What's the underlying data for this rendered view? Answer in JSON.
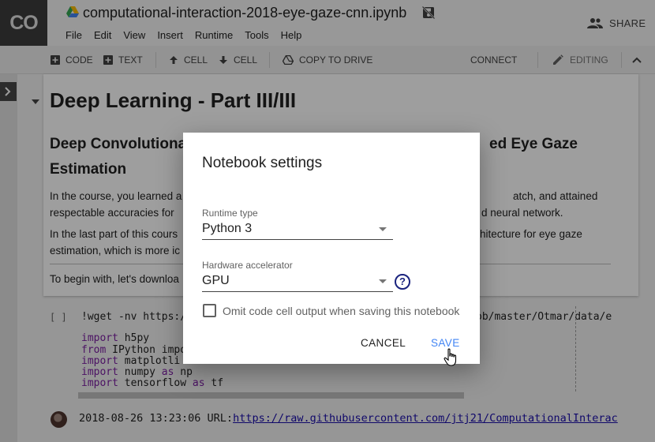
{
  "header": {
    "logo": "CO",
    "notebook_title": "computational-interaction-2018-eye-gaze-cnn.ipynb",
    "share_label": "SHARE",
    "menu": [
      "File",
      "Edit",
      "View",
      "Insert",
      "Runtime",
      "Tools",
      "Help"
    ]
  },
  "toolbar": {
    "code_label": "CODE",
    "text_label": "TEXT",
    "cell_up_label": "CELL",
    "cell_down_label": "CELL",
    "copy_label": "COPY TO DRIVE",
    "connect_label": "CONNECT",
    "editing_label": "EDITING"
  },
  "text_cell": {
    "h1": "Deep Learning - Part III/III",
    "h2_left": "Deep Convolutiona",
    "h2_right": "ed Eye Gaze",
    "h2_line2": "Estimation",
    "p1_line1_left": "In the course, you learned a",
    "p1_line1_right": "atch, and attained",
    "p1_line2_left": "respectable accuracies for",
    "p1_line2_right": "d neural network.",
    "p2_line1_left": "In the last part of this cours",
    "p2_line1_right": "hitecture for eye gaze",
    "p2_line2_left": "estimation, which is more ic",
    "p3": "To begin with, let's downloa"
  },
  "code_cell": {
    "prompt": "[ ]",
    "line1_left": "!wget -nv https:/",
    "line1_right": "ob/master/Otmar/data/e",
    "lines": [
      {
        "kw": "import",
        "rest": " h5py"
      },
      {
        "kw": "from",
        "rest": " IPython impo"
      },
      {
        "kw": "import",
        "rest": " matplotli"
      },
      {
        "kw": "import",
        "rest": " numpy ",
        "kw2": "as",
        "rest2": " np"
      },
      {
        "kw": "import",
        "rest": " tensorflow ",
        "kw2": "as",
        "rest2": " tf"
      }
    ]
  },
  "output": {
    "prefix": "2018-08-26 13:23:06 URL:",
    "link": "https://raw.githubusercontent.com/jtj21/ComputationalInterac"
  },
  "dialog": {
    "title": "Notebook settings",
    "runtime_label": "Runtime type",
    "runtime_value": "Python 3",
    "accelerator_label": "Hardware accelerator",
    "accelerator_value": "GPU",
    "help_glyph": "?",
    "omit_output_label": "Omit code cell output when saving this notebook",
    "omit_output_checked": false,
    "cancel_label": "CANCEL",
    "save_label": "SAVE"
  },
  "colors": {
    "accent": "#4285f4",
    "help_icon": "#1a237e",
    "keyword": "#7b1fa2"
  }
}
